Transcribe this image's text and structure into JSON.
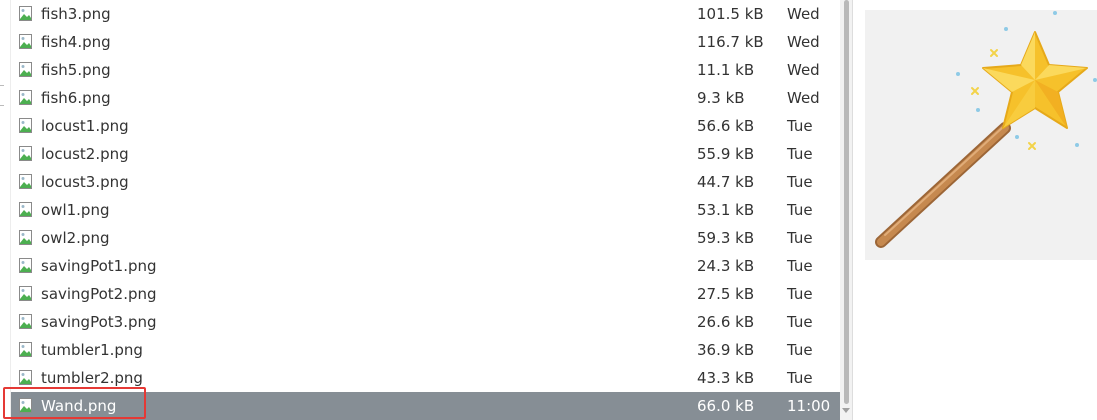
{
  "files": [
    {
      "name": "fish3.png",
      "size": "101.5 kB",
      "modified": "Wed",
      "selected": false
    },
    {
      "name": "fish4.png",
      "size": "116.7 kB",
      "modified": "Wed",
      "selected": false
    },
    {
      "name": "fish5.png",
      "size": "11.1 kB",
      "modified": "Wed",
      "selected": false
    },
    {
      "name": "fish6.png",
      "size": "9.3 kB",
      "modified": "Wed",
      "selected": false
    },
    {
      "name": "locust1.png",
      "size": "56.6 kB",
      "modified": "Tue",
      "selected": false
    },
    {
      "name": "locust2.png",
      "size": "55.9 kB",
      "modified": "Tue",
      "selected": false
    },
    {
      "name": "locust3.png",
      "size": "44.7 kB",
      "modified": "Tue",
      "selected": false
    },
    {
      "name": "owl1.png",
      "size": "53.1 kB",
      "modified": "Tue",
      "selected": false
    },
    {
      "name": "owl2.png",
      "size": "59.3 kB",
      "modified": "Tue",
      "selected": false
    },
    {
      "name": "savingPot1.png",
      "size": "24.3 kB",
      "modified": "Tue",
      "selected": false
    },
    {
      "name": "savingPot2.png",
      "size": "27.5 kB",
      "modified": "Tue",
      "selected": false
    },
    {
      "name": "savingPot3.png",
      "size": "26.6 kB",
      "modified": "Tue",
      "selected": false
    },
    {
      "name": "tumbler1.png",
      "size": "36.9 kB",
      "modified": "Tue",
      "selected": false
    },
    {
      "name": "tumbler2.png",
      "size": "43.3 kB",
      "modified": "Tue",
      "selected": false
    },
    {
      "name": "Wand.png",
      "size": "66.0 kB",
      "modified": "11:00",
      "selected": true
    }
  ],
  "icons": {
    "file": "image-file-icon",
    "preview": "magic-wand-image"
  },
  "colors": {
    "selected_row": "#868e95",
    "highlight_box": "#e53935",
    "preview_bg": "#f1f1f1",
    "wand_star": "#f6c12b",
    "wand_stick": "#c6894f"
  }
}
